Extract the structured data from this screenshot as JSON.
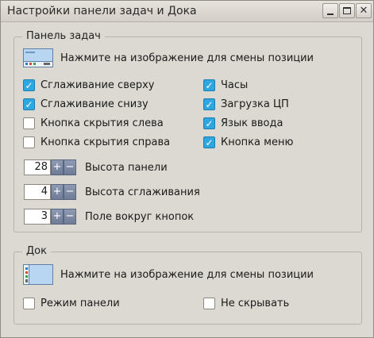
{
  "window": {
    "title": "Настройки панели задач и Дока",
    "min_icon": "minimize-icon",
    "max_icon": "maximize-icon",
    "close_icon": "close-icon",
    "close_glyph": "✕"
  },
  "taskbar": {
    "group_title": "Панель задач",
    "position_hint": "Нажмите на изображение для смены позиции",
    "checkboxes_left": [
      {
        "label": "Сглаживание сверху",
        "checked": true
      },
      {
        "label": "Сглаживание снизу",
        "checked": true
      },
      {
        "label": "Кнопка скрытия слева",
        "checked": false
      },
      {
        "label": "Кнопка скрытия справа",
        "checked": false
      }
    ],
    "checkboxes_right": [
      {
        "label": "Часы",
        "checked": true
      },
      {
        "label": "Загрузка ЦП",
        "checked": true
      },
      {
        "label": "Язык ввода",
        "checked": true
      },
      {
        "label": "Кнопка меню",
        "checked": true
      }
    ],
    "spinners": [
      {
        "value": "28",
        "label": "Высота панели"
      },
      {
        "value": "4",
        "label": "Высота сглаживания"
      },
      {
        "value": "3",
        "label": "Поле вокруг кнопок"
      }
    ],
    "plus": "+",
    "minus": "−"
  },
  "dock": {
    "group_title": "Док",
    "position_hint": "Нажмите на изображение для смены позиции",
    "checkboxes": [
      {
        "label": "Режим панели",
        "checked": false
      },
      {
        "label": "Не скрывать",
        "checked": false
      }
    ]
  },
  "colors": {
    "checkbox_on": "#2ea6e0",
    "window_bg": "#dcd8d2",
    "spin_button": "#7b87a1"
  }
}
